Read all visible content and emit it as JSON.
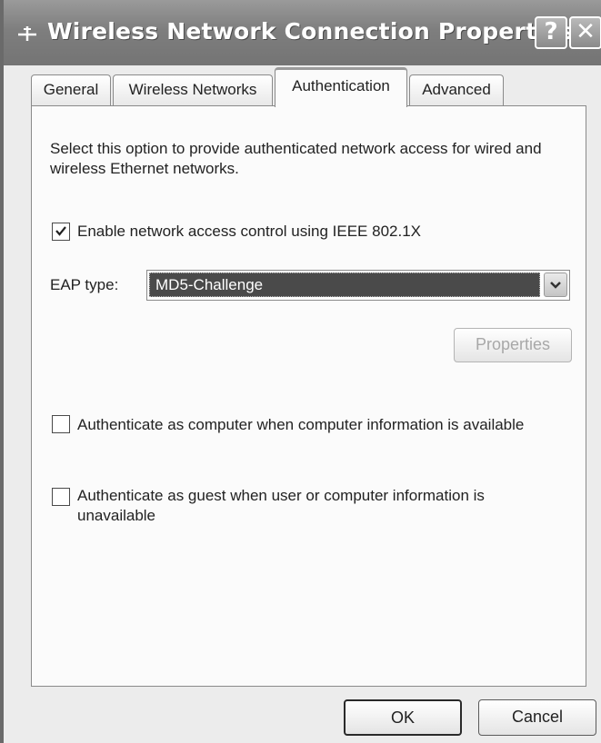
{
  "window": {
    "title": "Wireless Network Connection Properties",
    "help_glyph": "?",
    "close_glyph": "✕"
  },
  "tabs": [
    {
      "label": "General",
      "active": false
    },
    {
      "label": "Wireless Networks",
      "active": false
    },
    {
      "label": "Authentication",
      "active": true
    },
    {
      "label": "Advanced",
      "active": false
    }
  ],
  "authentication": {
    "description": "Select this option to provide authenticated network access for wired and wireless Ethernet networks.",
    "enable_8021x": {
      "label": "Enable network access control using IEEE 802.1X",
      "checked": true
    },
    "eap_type_label": "EAP type:",
    "eap_type_value": "MD5-Challenge",
    "properties_button": "Properties",
    "properties_enabled": false,
    "auth_as_computer": {
      "label": "Authenticate as computer when computer information is available",
      "checked": false
    },
    "auth_as_guest": {
      "label": "Authenticate as guest when user or computer information is unavailable",
      "checked": false
    }
  },
  "footer": {
    "ok_label": "OK",
    "cancel_label": "Cancel"
  },
  "icons": {
    "title": "network-connection-icon",
    "help": "help-icon",
    "close": "close-icon",
    "dropdown": "chevron-down-icon",
    "check": "checkmark-icon"
  }
}
